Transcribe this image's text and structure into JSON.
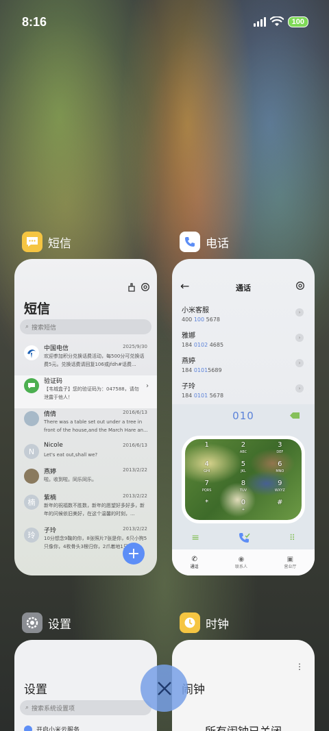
{
  "status": {
    "time": "8:16",
    "battery": "100"
  },
  "apps": {
    "sms": {
      "name": "短信",
      "screen": {
        "title": "短信",
        "search_placeholder": "搜索短信",
        "messages": [
          {
            "name": "中国电信",
            "date": "2025/9/30",
            "text": "欢迎参加积分兑换话费活动，每500分可兑换话费5元。兑换话费请回复106或jfdh#话费..."
          },
          {
            "name": "验证码",
            "date": "",
            "text": "【韦城盒子】您的验证码为：047588，请勿泄露于他人！"
          },
          {
            "name": "倩倩",
            "date": "2016/6/13",
            "text": "There was a table set out under a tree in front of the house,and the March Hare an..."
          },
          {
            "name": "Nicole",
            "date": "2016/6/13",
            "text": "Let's eat out,shall we?",
            "avatar": "N"
          },
          {
            "name": "燕婷",
            "date": "2013/2/22",
            "text": "啦。收到啦。同乐同乐。"
          },
          {
            "name": "紫楠",
            "date": "2013/2/22",
            "text": "新年的祝福数不胜数，新年的愿望好多好多，新年的问候依旧美好，在这个温馨的时刻，...",
            "avatar": "楠"
          },
          {
            "name": "子玲",
            "date": "2013/2/22",
            "text": "10分想念9鞠的你，8张照片7张是你，6只小狗5只像你，4枚骨头3根归你，2爪着地1只...",
            "avatar": "玲"
          }
        ]
      }
    },
    "phone": {
      "name": "电话",
      "screen": {
        "title": "通话",
        "contacts": [
          {
            "name": "小米客服",
            "pre": "400 ",
            "hl": "100",
            "post": " 5678"
          },
          {
            "name": "雅娜",
            "pre": "184 ",
            "hl": "0102",
            "post": " 4685"
          },
          {
            "name": "燕婷",
            "pre": "184 ",
            "hl": "0101",
            "post": "5689"
          },
          {
            "name": "子玲",
            "pre": "184 ",
            "hl": "0101",
            "post": " 5678"
          }
        ],
        "dial_number": "010",
        "keys": [
          {
            "d": "1",
            "l": ""
          },
          {
            "d": "2",
            "l": "ABC"
          },
          {
            "d": "3",
            "l": "DEF"
          },
          {
            "d": "4",
            "l": "GHI"
          },
          {
            "d": "5",
            "l": "JKL"
          },
          {
            "d": "6",
            "l": "MNO"
          },
          {
            "d": "7",
            "l": "PQRS"
          },
          {
            "d": "8",
            "l": "TUV"
          },
          {
            "d": "9",
            "l": "WXYZ"
          },
          {
            "d": "*",
            "l": ""
          },
          {
            "d": "0",
            "l": "+"
          },
          {
            "d": "#",
            "l": ""
          }
        ],
        "nav": [
          "通话",
          "联系人",
          "营业厅"
        ]
      }
    },
    "settings": {
      "name": "设置",
      "screen": {
        "title": "设置",
        "search_placeholder": "搜索系统设置项",
        "first_item": "开启小米云服务"
      }
    },
    "clock": {
      "name": "时钟",
      "screen": {
        "title": "闹钟",
        "message": "所有闹钟已关闭"
      }
    }
  },
  "colors": {
    "accent": "#5d8ef6",
    "green": "#7ed957"
  }
}
